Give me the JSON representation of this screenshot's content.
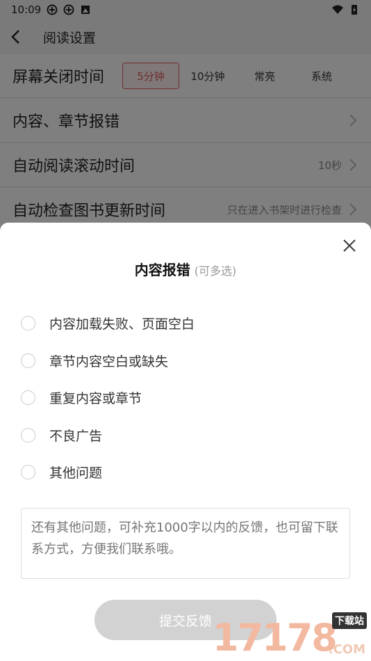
{
  "status_bar": {
    "time": "10:09"
  },
  "header": {
    "title": "阅读设置"
  },
  "settings": {
    "screen_off": {
      "label": "屏幕关闭时间",
      "options": [
        "5分钟",
        "10分钟",
        "常亮",
        "系统"
      ],
      "selected": "5分钟"
    },
    "report": {
      "label": "内容、章节报错"
    },
    "auto_scroll": {
      "label": "自动阅读滚动时间",
      "value": "10秒"
    },
    "update_check": {
      "label": "自动检查图书更新时间",
      "value": "只在进入书架时进行检查"
    }
  },
  "sheet": {
    "title": "内容报错",
    "subtitle": "(可多选)",
    "options": [
      "内容加载失败、页面空白",
      "章节内容空白或缺失",
      "重复内容或章节",
      "不良广告",
      "其他问题"
    ],
    "feedback_placeholder": "还有其他问题，可补充1000字以内的反馈，也可留下联系方式，方便我们联系哦。",
    "submit_label": "提交反馈"
  },
  "watermark": {
    "number": "17178",
    "tag": "下载站",
    "suffix": ".COM"
  },
  "colors": {
    "accent": "#e25a5a",
    "button_disabled": "#d2d2d2"
  }
}
